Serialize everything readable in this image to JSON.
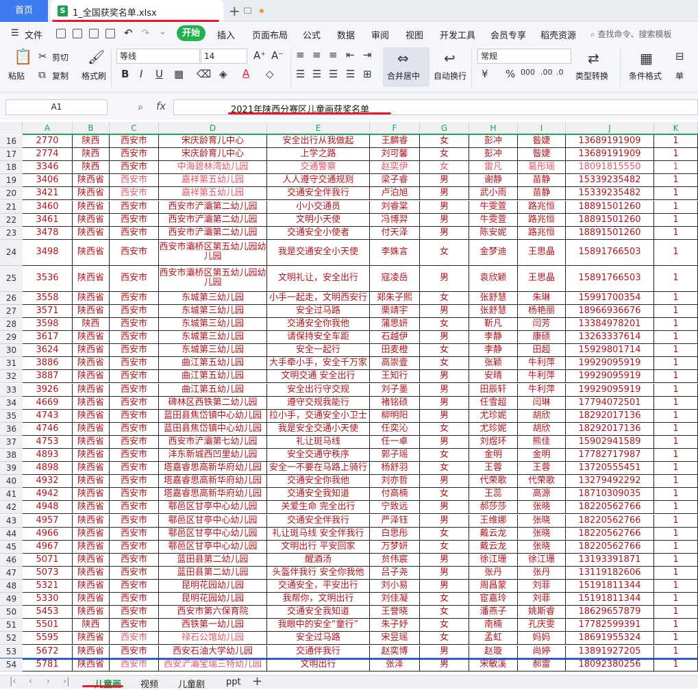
{
  "titlebar": {
    "home_label": "首页",
    "file_icon": "S",
    "file_name": "1_全国获奖名单.xlsx",
    "new_tab": "+"
  },
  "menu": {
    "file": "文件",
    "items": [
      "开始",
      "插入",
      "页面布局",
      "公式",
      "数据",
      "审阅",
      "视图",
      "开发工具",
      "会员专享",
      "稻壳资源"
    ],
    "search": "查找命令、搜索模板"
  },
  "ribbon": {
    "paste": "粘贴",
    "cut": "剪切",
    "copy": "复制",
    "format_painter": "格式刷",
    "font_name": "等线",
    "font_size": "14",
    "merge_center": "合并居中",
    "wrap_text": "自动换行",
    "number_format": "常规",
    "type_convert": "类型转换",
    "conditional_format": "条件格式",
    "single": "单"
  },
  "formula": {
    "cell_ref": "A1",
    "fx": "fx",
    "content": "2021年陕西分赛区儿童画获奖名单"
  },
  "columns": [
    "A",
    "B",
    "C",
    "D",
    "E",
    "F",
    "G",
    "H",
    "I",
    "J",
    "K"
  ],
  "rows": [
    {
      "n": "16",
      "c": [
        "2770",
        "陕西",
        "西安市",
        "宋庆龄育儿中心",
        "安全出行从我做起",
        "王麟睿",
        "女",
        "彭冲",
        "昝婕",
        "13689191909",
        "1"
      ]
    },
    {
      "n": "17",
      "c": [
        "2774",
        "陕西",
        "西安市",
        "宋庆龄育儿中心",
        "上学之路",
        "刘可馨",
        "女",
        "彭冲",
        "昝婕",
        "13689191909",
        "1"
      ]
    },
    {
      "n": "18",
      "c": [
        "3346",
        "陕西",
        "西安市",
        "中海碧林湾幼儿园",
        "交通警察",
        "赵奕伊",
        "女",
        "雷凡",
        "葛彤瑶",
        "18091815550",
        "1"
      ]
    },
    {
      "n": "19",
      "c": [
        "3406",
        "陕西省",
        "西安市",
        "嘉祥第五幼儿园",
        "人人遵守交通规则",
        "梁子睿",
        "男",
        "谢静",
        "苗静",
        "15339235482",
        "1"
      ]
    },
    {
      "n": "20",
      "c": [
        "3421",
        "陕西省",
        "西安市",
        "嘉祥第五幼儿园",
        "交通安全伴我行",
        "卢泊旭",
        "男",
        "武小雨",
        "苗静",
        "15339235482",
        "1"
      ]
    },
    {
      "n": "21",
      "c": [
        "3460",
        "陕西省",
        "西安市",
        "西安市浐灞第二幼儿园",
        "小小交通员",
        "刘睿棠",
        "男",
        "牛雯萱",
        "路兆恒",
        "18891501260",
        "1"
      ]
    },
    {
      "n": "22",
      "c": [
        "3461",
        "陕西省",
        "西安市",
        "西安市浐灞第二幼儿园",
        "文明小天使",
        "冯博羿",
        "男",
        "牛雯萱",
        "路兆恒",
        "18891501260",
        "1"
      ]
    },
    {
      "n": "23",
      "c": [
        "3478",
        "陕西省",
        "西安市",
        "西安市浐灞第二幼儿园",
        "交通安全小使者",
        "付天泽",
        "男",
        "陈安妮",
        "路兆恒",
        "18891501260",
        "1"
      ]
    },
    {
      "n": "24",
      "c": [
        "3498",
        "陕西省",
        "西安市",
        "西安市灞桥区第五幼儿园幼儿园",
        "我是交通安全小天使",
        "李姝言",
        "女",
        "金梦迪",
        "王思晶",
        "15891766503",
        "1"
      ]
    },
    {
      "n": "25",
      "c": [
        "3536",
        "陕西省",
        "西安市",
        "西安市灞桥区第五幼儿园幼儿园",
        "文明礼让，安全出行",
        "寇凌岳",
        "男",
        "袁欣颖",
        "王思晶",
        "15891766503",
        "1"
      ]
    },
    {
      "n": "26",
      "c": [
        "3558",
        "陕西省",
        "西安市",
        "东城第三幼儿园",
        "小手一起走，文明西安行",
        "郑朱子熙",
        "女",
        "张舒慧",
        "朱琳",
        "15991700354",
        "1"
      ]
    },
    {
      "n": "27",
      "c": [
        "3571",
        "陕西省",
        "西安市",
        "东城第三幼儿园",
        "安全过马路",
        "栗靖宇",
        "男",
        "张舒慧",
        "杨艳丽",
        "18966936676",
        "1"
      ]
    },
    {
      "n": "28",
      "c": [
        "3598",
        "陕西",
        "西安市",
        "东城第三幼儿园",
        "交通安全你我他",
        "蒲思妍",
        "女",
        "靳凡",
        "闫芳",
        "13384978201",
        "1"
      ]
    },
    {
      "n": "29",
      "c": [
        "3617",
        "陕西省",
        "西安市",
        "东城第三幼儿园",
        "请保持安全车距",
        "石越伊",
        "男",
        "李静",
        "康硕",
        "13263337614",
        "1"
      ]
    },
    {
      "n": "30",
      "c": [
        "3624",
        "陕西省",
        "西安市",
        "东城第三幼儿园",
        "安全一起行",
        "田麦橙",
        "女",
        "李静",
        "田超",
        "15929801714",
        "1"
      ]
    },
    {
      "n": "31",
      "c": [
        "3886",
        "陕西省",
        "西安市",
        "曲江第五幼儿园",
        "大手牵小手，安全千万家",
        "高崇壹",
        "女",
        "张颖",
        "牛利萍",
        "19929095919",
        "1"
      ]
    },
    {
      "n": "32",
      "c": [
        "3887",
        "陕西省",
        "西安市",
        "曲江第五幼儿园",
        "文明交通 安全出行",
        "王知行",
        "男",
        "安晴",
        "牛利萍",
        "19929095919",
        "1"
      ]
    },
    {
      "n": "33",
      "c": [
        "3926",
        "陕西省",
        "西安市",
        "曲江第五幼儿园",
        "安全出行守交规",
        "刘子墨",
        "男",
        "田辰轩",
        "牛利萍",
        "19929095919",
        "1"
      ]
    },
    {
      "n": "34",
      "c": [
        "4669",
        "陕西省",
        "西安市",
        "碑林区西铁第二幼儿园",
        "遵守交规我能行",
        "褚铭硕",
        "男",
        "任雪超",
        "闫琳",
        "17794072501",
        "1"
      ]
    },
    {
      "n": "35",
      "c": [
        "4743",
        "陕西省",
        "西安市",
        "蓝田县焦岱镇中心幼儿园",
        "拉小手，交通安全小卫士",
        "柳明阳",
        "男",
        "尤珍妮",
        "胡欣",
        "18292017136",
        "1"
      ]
    },
    {
      "n": "36",
      "c": [
        "4746",
        "陕西省",
        "西安市",
        "蓝田县焦岱镇中心幼儿园",
        "我是安全交通小天使",
        "任奕沁",
        "女",
        "尤珍妮",
        "胡欣",
        "18292017136",
        "1"
      ]
    },
    {
      "n": "37",
      "c": [
        "4753",
        "陕西省",
        "西安市",
        "西安市浐灞第七幼儿园",
        "礼让斑马线",
        "任一卓",
        "男",
        "刘煜环",
        "熊佳",
        "15902941589",
        "1"
      ]
    },
    {
      "n": "38",
      "c": [
        "4893",
        "陕西省",
        "西安市",
        "沣东新城西凹里幼儿园",
        "安全交通守秩序",
        "郭子瑶",
        "女",
        "金明",
        "金明",
        "17782717987",
        "1"
      ]
    },
    {
      "n": "39",
      "c": [
        "4898",
        "陕西省",
        "西安市",
        "塔嘉睿思高新华府幼儿园",
        "安全一不要在马路上骑行",
        "杨舒羽",
        "女",
        "王蓉",
        "王蓉",
        "13720555451",
        "1"
      ]
    },
    {
      "n": "40",
      "c": [
        "4932",
        "陕西省",
        "西安市",
        "塔嘉睿思高新华府幼儿园",
        "交通安全你我他",
        "刘亦哲",
        "男",
        "代荣歌",
        "代荣歌",
        "13279492292",
        "1"
      ]
    },
    {
      "n": "41",
      "c": [
        "4942",
        "陕西省",
        "西安市",
        "塔嘉睿思高新华府幼儿园",
        "交通安全我知道",
        "付高楠",
        "女",
        "王蕊",
        "高源",
        "18710309035",
        "1"
      ]
    },
    {
      "n": "42",
      "c": [
        "4948",
        "陕西省",
        "西安市",
        "鄠邑区甘亭中心幼儿园",
        "关爱生命 完全出行",
        "宁致远",
        "男",
        "郝莎莎",
        "张晓",
        "18220562766",
        "1"
      ]
    },
    {
      "n": "43",
      "c": [
        "4957",
        "陕西省",
        "西安市",
        "鄠邑区甘亭中心幼儿园",
        "交通安全伴我行",
        "严泽钰",
        "男",
        "王维娜",
        "张晓",
        "18220562766",
        "1"
      ]
    },
    {
      "n": "44",
      "c": [
        "4966",
        "陕西省",
        "西安市",
        "鄠邑区甘亭中心幼儿园",
        "礼让斑马线 安全伴我行",
        "白思彤",
        "女",
        "戴云龙",
        "张晓",
        "18220562766",
        "1"
      ]
    },
    {
      "n": "45",
      "c": [
        "4967",
        "陕西省",
        "西安市",
        "鄠邑区甘亭中心幼儿园",
        "文明出行 平安回家",
        "万梦妍",
        "女",
        "戴云龙",
        "张晓",
        "18220562766",
        "1"
      ]
    },
    {
      "n": "46",
      "c": [
        "5071",
        "陕西省",
        "西安市",
        "蓝田县第二幼儿园",
        "醒酒汤",
        "贠伟宸",
        "男",
        "徐江珊",
        "徐江珊",
        "13193391871",
        "1"
      ]
    },
    {
      "n": "47",
      "c": [
        "5073",
        "陕西省",
        "西安市",
        "蓝田县第二幼儿园",
        "头盔伴我行 安全你我他",
        "吕子尧",
        "男",
        "张丹",
        "张丹",
        "13119182606",
        "1"
      ]
    },
    {
      "n": "48",
      "c": [
        "5321",
        "陕西省",
        "西安市",
        "昆明花园幼儿园",
        "交通安全，平安出行",
        "刘小易",
        "男",
        "周昌蒙",
        "刘菲",
        "15191811344",
        "1"
      ]
    },
    {
      "n": "49",
      "c": [
        "5330",
        "陕西省",
        "西安市",
        "昆明花园幼儿园",
        "我帮你，文明出行",
        "刘佳凝",
        "女",
        "宦嘉玲",
        "刘菲",
        "15191811344",
        "1"
      ]
    },
    {
      "n": "50",
      "c": [
        "5453",
        "陕西省",
        "西安市",
        "西安市第六保育院",
        "交通安全我知道",
        "王誉晓",
        "女",
        "潘燕子",
        "姚斯睿",
        "18629657879",
        "1"
      ]
    },
    {
      "n": "51",
      "c": [
        "5501",
        "陕西",
        "西安市",
        "西铁第一幼儿园",
        "我眼中的安全“童行”",
        "朱子妤",
        "女",
        "南楠",
        "孔庆雯",
        "17782599391",
        "1"
      ]
    },
    {
      "n": "52",
      "c": [
        "5595",
        "陕西省",
        "西安市",
        "禄石公馆幼儿园",
        "安全过马路",
        "宋昱瑶",
        "女",
        "孟虹",
        "妈妈",
        "18691955324",
        "1"
      ]
    },
    {
      "n": "53",
      "c": [
        "5672",
        "陕西省",
        "西安市",
        "西安石油大学幼儿园",
        "交通伴我行",
        "赵奕博",
        "男",
        "赵璇",
        "尚婷",
        "13891927205",
        "1"
      ]
    },
    {
      "n": "54",
      "c": [
        "5781",
        "陕西省",
        "西安市",
        "西安浐灞宝瑞三特幼儿园",
        "文明出行",
        "张泽",
        "男",
        "宋敏溪",
        "郝雷",
        "18092380256",
        "1"
      ]
    }
  ],
  "sheets": {
    "tabs": [
      "儿童画",
      "视频",
      "儿童剧",
      "ppt"
    ],
    "add": "+"
  },
  "colors": {
    "text_red": "#b3141c",
    "text_pink": "#e05a6a",
    "accent_green": "#22b14c",
    "home_blue": "#3d7cf0",
    "mark_red": "#e8192c",
    "mark_blue": "#2b5cc9"
  }
}
